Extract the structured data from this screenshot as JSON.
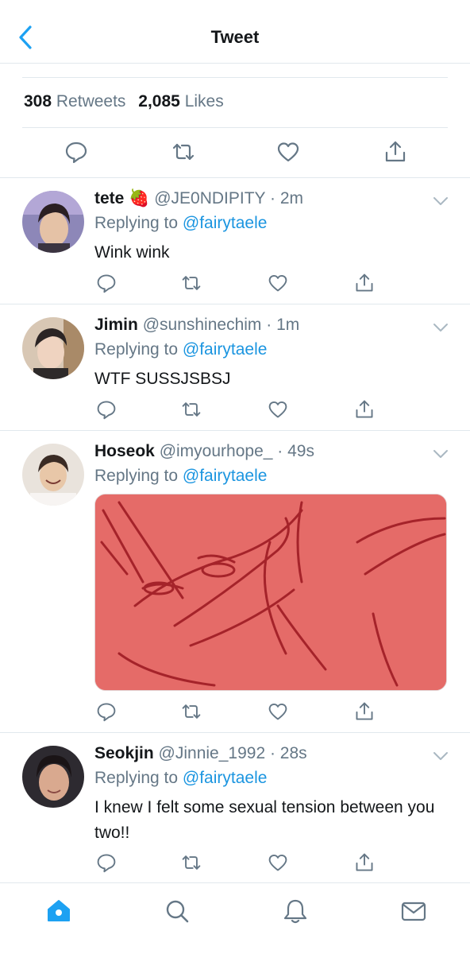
{
  "header": {
    "title": "Tweet",
    "back_icon": "chevron-left-icon"
  },
  "stats": {
    "retweets_count": "308",
    "retweets_label": "Retweets",
    "likes_count": "2,085",
    "likes_label": "Likes"
  },
  "colors": {
    "accent": "#1b95e0",
    "muted": "#657786",
    "text": "#14171a",
    "border": "#e1e8ed",
    "media_bg": "#e56b68"
  },
  "replies": [
    {
      "name": "tete",
      "emoji": "🍓",
      "handle": "@JE0NDIPITY",
      "time": "· 2m",
      "replying_prefix": "Replying to",
      "mention": "@fairytaele",
      "text": "Wink wink"
    },
    {
      "name": "Jimin",
      "handle": "@sunshinechim",
      "time": "· 1m",
      "replying_prefix": "Replying to",
      "mention": "@fairytaele",
      "text": "WTF SUSSJSBSJ"
    },
    {
      "name": "Hoseok",
      "handle": "@imyourhope_",
      "time": "· 49s",
      "replying_prefix": "Replying to",
      "mention": "@fairytaele",
      "media": "red meme image"
    },
    {
      "name": "Seokjin",
      "handle": "@Jinnie_1992",
      "time": "· 28s",
      "replying_prefix": "Replying to",
      "mention": "@fairytaele",
      "text": "I knew I felt some sexual tension between you two!!"
    }
  ],
  "tabbar": {
    "items": [
      "home-icon",
      "search-icon",
      "notifications-icon",
      "messages-icon"
    ],
    "active": "home-icon"
  }
}
